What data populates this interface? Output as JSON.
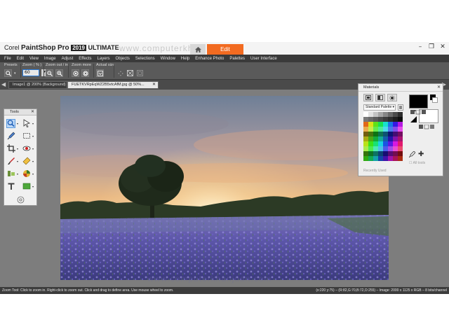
{
  "app": {
    "brand_corel": "Corel",
    "brand_product": "PaintShop",
    "brand_pro": "Pro",
    "brand_version": "2019",
    "brand_edition": "ULTIMATE",
    "home_icon": "home-icon",
    "edit_tab": "Edit",
    "watermark": "www.computerkhanjuan.com",
    "window_controls": [
      "–",
      "❐",
      "✕"
    ]
  },
  "menu": [
    "File",
    "Edit",
    "View",
    "Image",
    "Adjust",
    "Effects",
    "Layers",
    "Objects",
    "Selections",
    "Window",
    "Help",
    "Enhance Photo",
    "Palettes",
    "User Interface"
  ],
  "tool_options": {
    "presets_label": "Presets",
    "zoom_label": "Zoom ( % )",
    "zoom_value": "60",
    "zoom_out_in_label": "Zoom out / in",
    "zoom_more_label": "Zoom more",
    "actual_size_label": "Actual size"
  },
  "doc_tabs": [
    {
      "label": "Image1 @ 200% (Background)",
      "active": false
    },
    {
      "label": "FUETKVRpEqWZ2B5vtcAfM.jpg @ 50%...",
      "active": true
    }
  ],
  "tools_panel": {
    "title": "Tools",
    "close": "✕"
  },
  "materials": {
    "title": "Materials",
    "close": "✕",
    "palette": "Standard Palette",
    "recently_used": "Recently Used",
    "all_tools": "All tools",
    "fg_color": "#000000",
    "bg_color": "#ffffff"
  },
  "status": {
    "left": "Zoom Tool: Click to zoom in. Right-click to zoom out. Click and drag to define area. Use mouse wheel to zoom.",
    "right": "(x:220 y:75) – (R:82,G:70,B:72,O:255) – Image: 2000 x 1125 x RGB – 8 bits/channel"
  },
  "colors": {
    "accent": "#f26b21",
    "menubar": "#3a3a3a",
    "workspace": "#7d7d7d"
  }
}
